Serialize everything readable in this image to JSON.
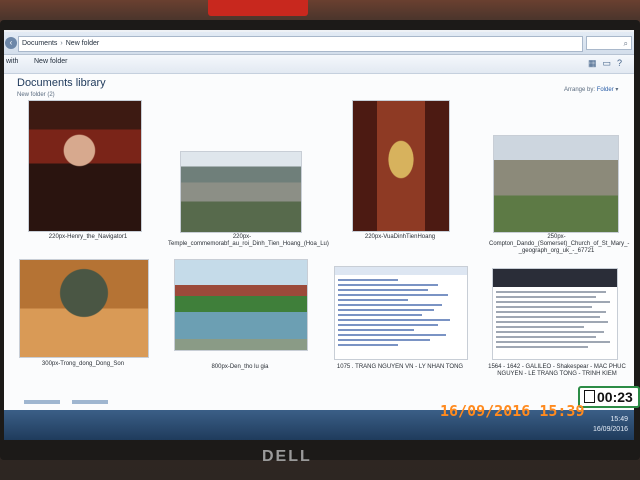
{
  "window": {
    "breadcrumb": [
      "Documents",
      "New folder"
    ],
    "search_glyph": "⌕",
    "toolbar": {
      "left_item": "with",
      "new_folder": "New folder"
    }
  },
  "library": {
    "title": "Documents library",
    "subtitle": "New folder (2)",
    "arrange_label": "Arrange by:",
    "arrange_value": "Folder"
  },
  "files": [
    {
      "name": "220px-Henry_the_Navigator1",
      "thumb": "portrait-icon"
    },
    {
      "name": "220px-Temple_commemorabf_au_roi_Dinh_Tien_Hoang_(Hoa_Lu)",
      "thumb": "temple-photo-icon"
    },
    {
      "name": "220px-VuaDinhTienHoang",
      "thumb": "statue-photo-icon"
    },
    {
      "name": "250px-Compton_Dando_(Somerset)_Church_of_St_Mary_-_geograph_org_uk_-_67721",
      "thumb": "church-photo-icon"
    },
    {
      "name": "300px-Trong_dong_Dong_Son",
      "thumb": "bronze-drum-photo-icon"
    },
    {
      "name": "800px-Den_tho lu gia",
      "thumb": "lake-temple-photo-icon"
    },
    {
      "name": "1075 . TRANG NGUYEN VN - LY NHAN TONG",
      "thumb": "document-page-icon"
    },
    {
      "name": "1564 - 1642 - GALILEO - Shakespear - MAC PHUC NGUYEN - LE TRANG TONG - TRINH KIEM",
      "thumb": "document-page-icon"
    }
  ],
  "taskbar": {
    "time": "15:49",
    "date": "16/09/2016"
  },
  "overlay": {
    "datestamp": "16/09/2016 15:39",
    "timer": "00:23"
  },
  "monitor": {
    "brand": "DELL"
  },
  "colors": {
    "accent": "#1e395b",
    "stamp": "#ff8a1e",
    "taskbar": "#1f3b5c"
  }
}
